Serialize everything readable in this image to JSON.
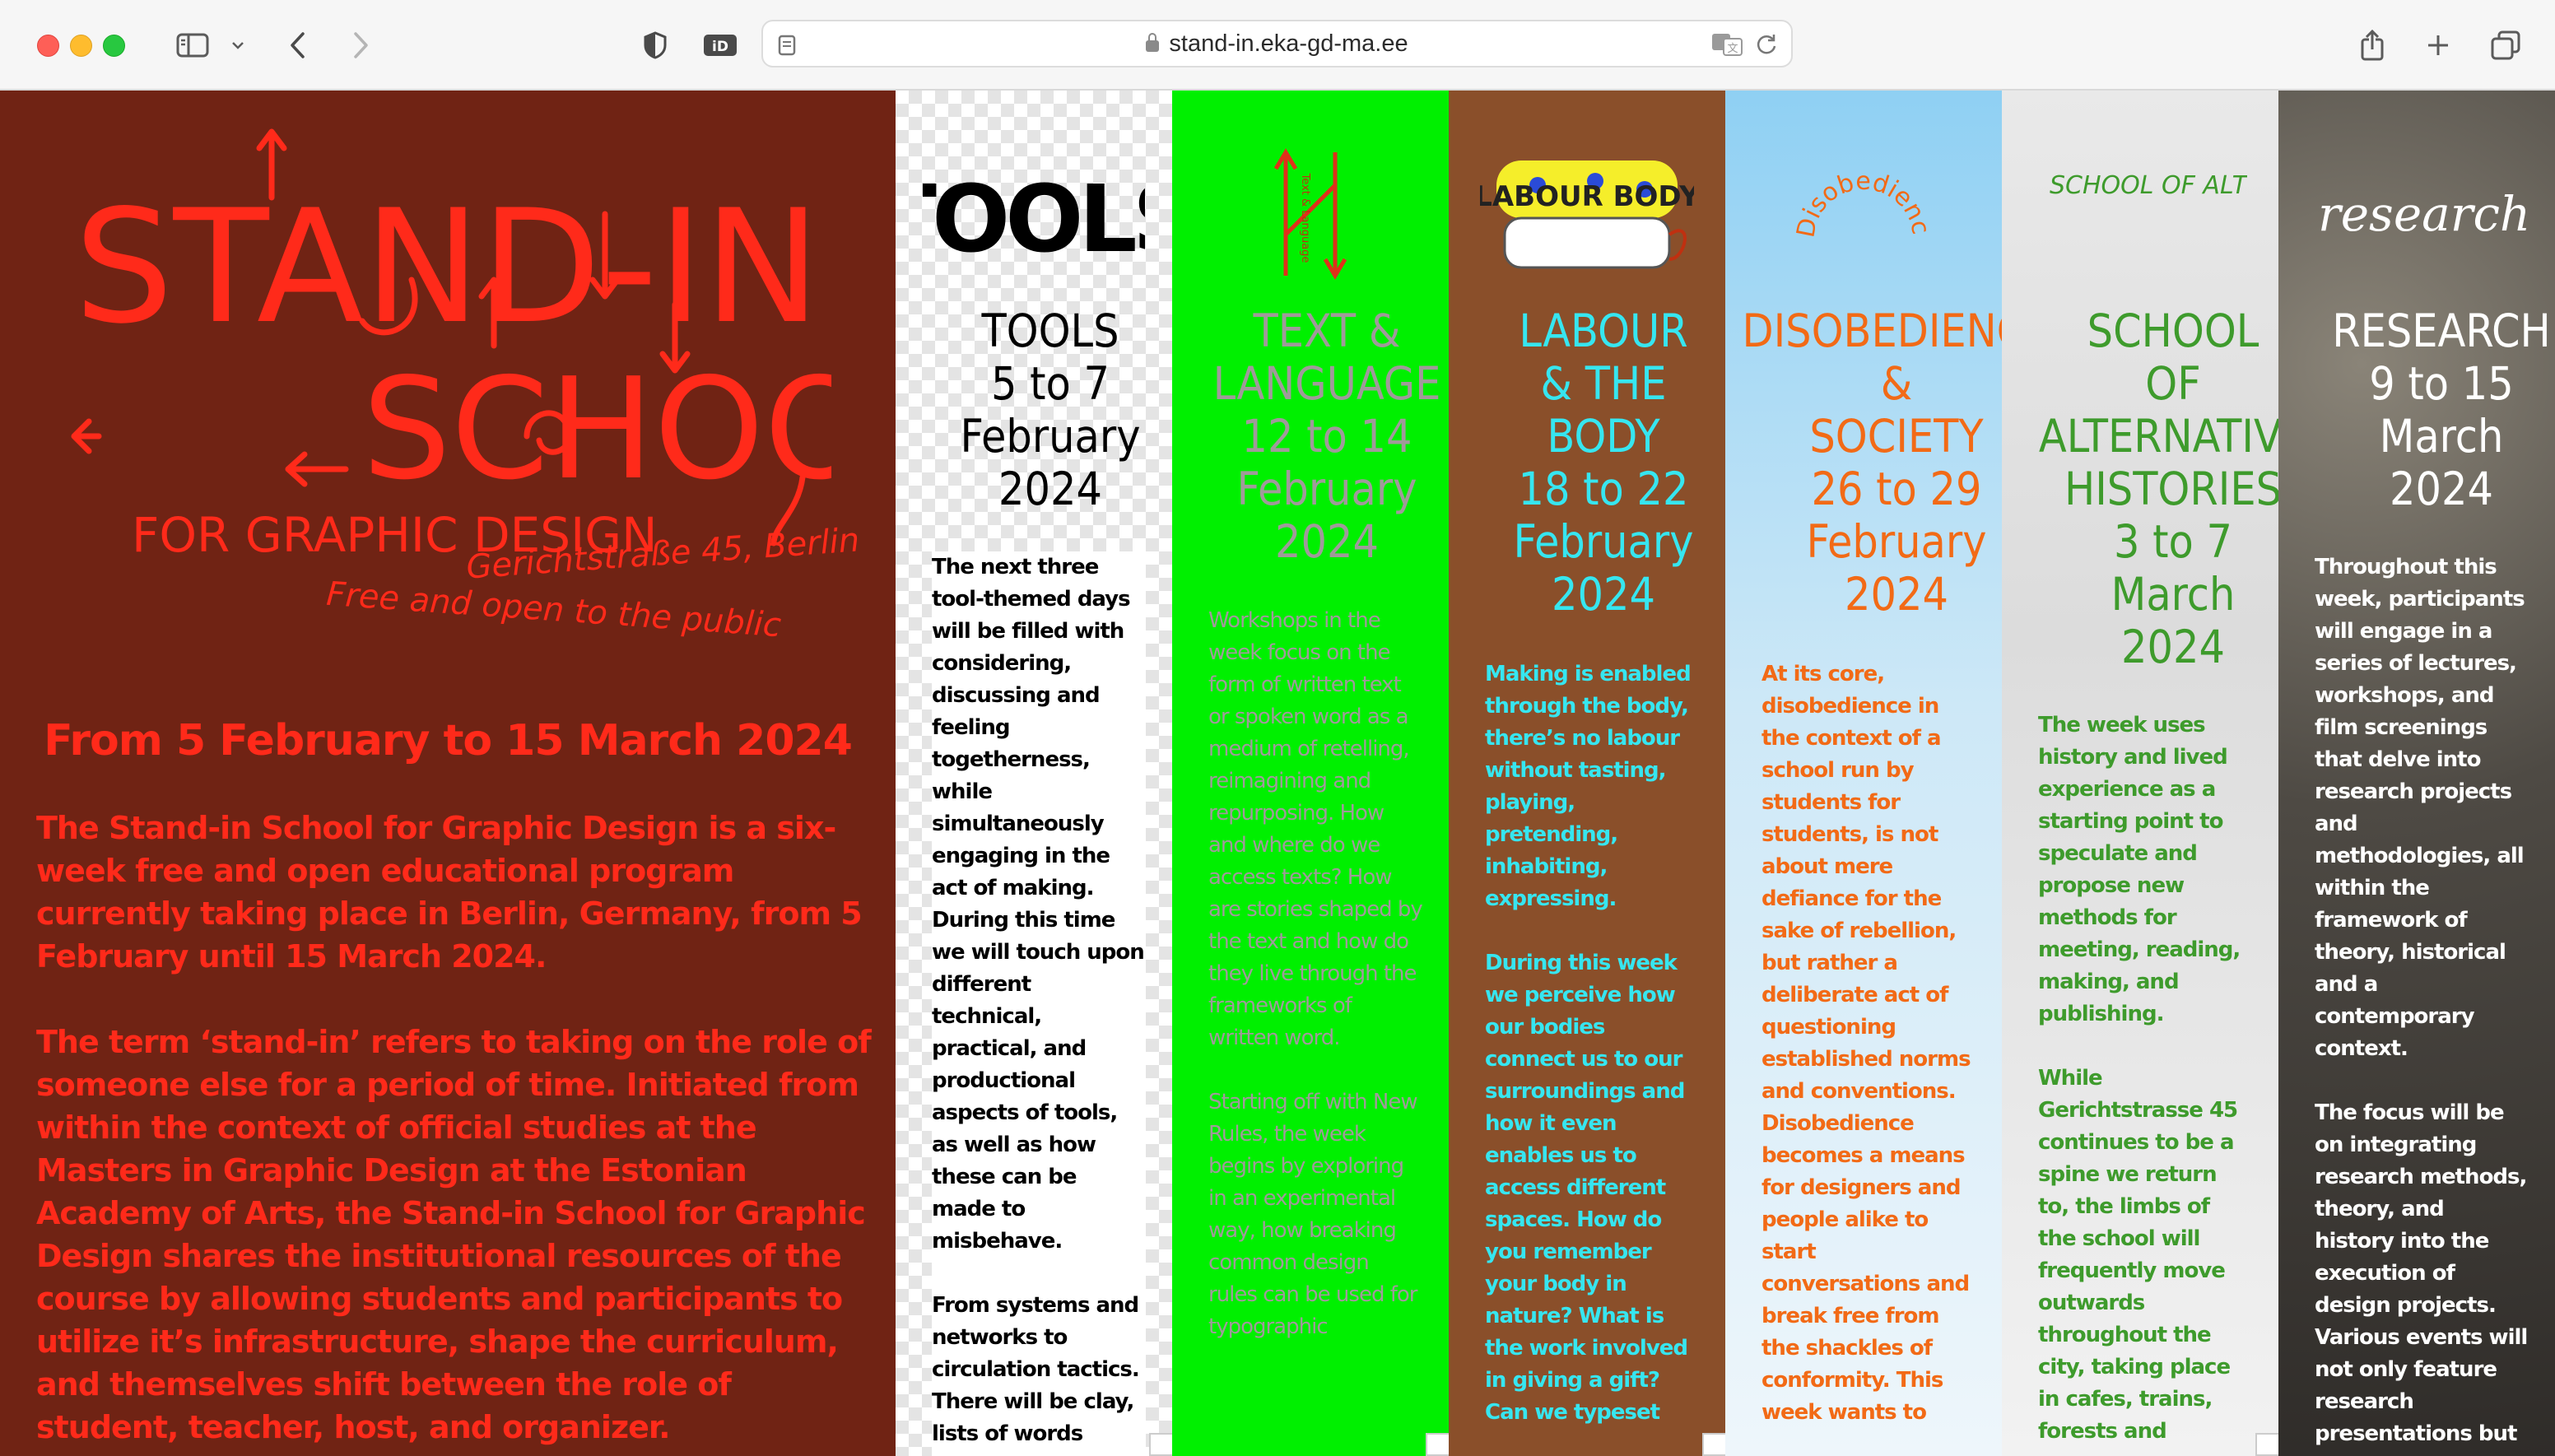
{
  "browser": {
    "url": "stand-in.eka-gd-ma.ee"
  },
  "intro": {
    "logo": {
      "line1": "STAND-IN",
      "line2": "SCHOOL",
      "line3": "FOR GRAPHIC DESIGN"
    },
    "address": "Gerichtstraße 45, Berlin",
    "free_line": "Free and open to the public",
    "dates": "From 5 February to 15 March 2024",
    "paragraphs": [
      "The Stand-in School for Graphic Design is a six-week free and open educational program currently taking place in Berlin, Germany, from 5 February until 15 March 2024.",
      "The term ‘stand-in’ refers to taking on the role of someone else for a period of time. Initiated from within the context of official studies at the Masters in Graphic Design at the Estonian Academy of Arts, the Stand-in School for Graphic Design shares the institutional resources of the course by allowing students and participants to utilize it’s infrastructure, shape the curriculum, and themselves shift between the role of student, teacher, host, and organizer."
    ]
  },
  "columns": [
    {
      "id": "tools",
      "logo_text": "TOOLS",
      "title_lines": [
        "TOOLS",
        "5 to 7",
        "February",
        "2024"
      ],
      "color": "#000000",
      "body": [
        "The next three tool-themed days will be filled with considering, discussing and feeling togetherness, while simultaneously engaging in the act of making. During this time we will touch upon different technical, practical, and productional aspects of tools, as well as how these can be made to misbehave.",
        "From systems and networks to circulation tactics. There will be clay, lists of words"
      ]
    },
    {
      "id": "text-language",
      "logo_text": "Text & Language",
      "title_lines": [
        "TEXT &",
        "LANGUAGE",
        "12 to 14",
        "February",
        "2024"
      ],
      "color": "#a09a9a",
      "body": [
        "Workshops in the week focus on the form of written text or spoken word as a medium of retelling, reimagining and repurposing. How and where do we access texts? How are stories shaped by the text and how do they live through the frameworks of written word.",
        "Starting off with New Rules, the week begins by exploring in an experimental way, how breaking common design rules can be used for typographic"
      ]
    },
    {
      "id": "labour-body",
      "logo_text": "LABOUR BODY",
      "title_lines": [
        "LABOUR",
        "& THE",
        "BODY",
        "18 to 22",
        "February",
        "2024"
      ],
      "color": "#36e6f0",
      "body": [
        "Making is enabled through the body, there’s no labour without tasting, playing, pretending, inhabiting, expressing.",
        "During this week we perceive how our bodies connect us to our surroundings and how it even enables us to access different spaces.  How do you remember your body in nature? What is the work involved in giving a gift? Can we typeset"
      ]
    },
    {
      "id": "disobedience-society",
      "logo_text": "Disobedience and Society",
      "title_lines": [
        "DISOBEDIENCE",
        "&",
        "SOCIETY",
        "26 to 29",
        "February",
        "2024"
      ],
      "color": "#f26a16",
      "body": [
        "At its core, disobedience in the context of a school run by students for students, is not about mere defiance for the sake of rebellion, but rather a deliberate act of questioning established norms and conventions. Disobedience becomes a means for designers and people alike to start conversations and break free from the shackles of conformity. This week wants to"
      ]
    },
    {
      "id": "alternative-histories",
      "logo_text": "SCHOOL OF ALTERNATIVE HISTORIES",
      "title_lines": [
        "SCHOOL",
        "OF",
        "ALTERNATIVE",
        "HISTORIES",
        "3 to 7",
        "March",
        "2024"
      ],
      "color": "#3e9b2c",
      "body": [
        "The week uses history and lived experience as a starting point to speculate and propose new methods for meeting, reading, making, and publishing.",
        "While Gerichtstrasse 45 continues to be a spine we return to, the limbs of the school will frequently move outwards throughout the city, taking place in cafes, trains, forests and"
      ]
    },
    {
      "id": "research",
      "logo_text": "research",
      "title_lines": [
        "RESEARCH",
        "9 to 15",
        "March",
        "2024"
      ],
      "color": "#ffffff",
      "body": [
        "Throughout this week, participants will engage in a series of lectures, workshops, and film screenings that delve into research projects and methodologies, all within the framework of theory, historical and a contemporary context.",
        "The focus will be on integrating research methods, theory, and history into the execution of design projects. Various events will not only feature research presentations but also encourage"
      ]
    }
  ],
  "colors": {
    "intro_bg": "#702314",
    "intro_text": "#ff2a1a",
    "text_language_bg": "#00f000",
    "labour_bg": "#8a4f2a"
  }
}
